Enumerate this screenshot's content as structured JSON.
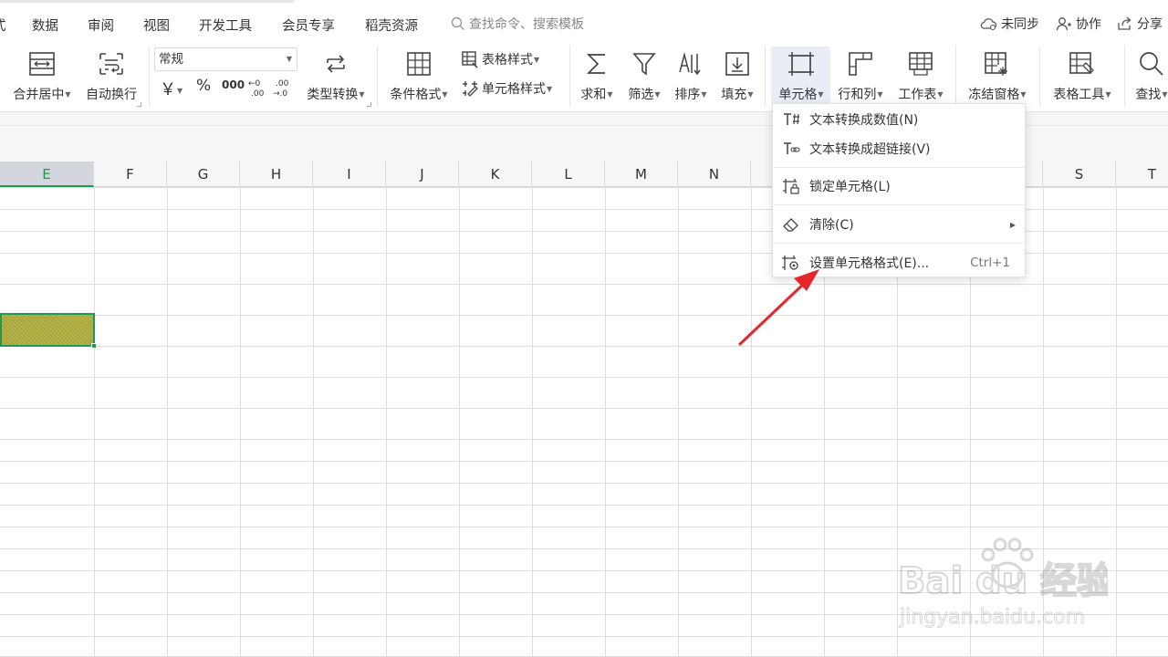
{
  "menu": {
    "partial_left": "式",
    "items": [
      "数据",
      "审阅",
      "视图",
      "开发工具",
      "会员专享",
      "稻壳资源"
    ],
    "search_placeholder": "查找命令、搜索模板",
    "right": {
      "sync": "未同步",
      "collab": "协作",
      "share": "分享"
    }
  },
  "ribbon": {
    "merge": "合并居中",
    "wrap": "自动换行",
    "format_value": "常规",
    "currency": "￥",
    "percent": "%",
    "thousands": "000",
    "dec_inc": "←0 .00",
    "dec_dec": ".00 →.0",
    "type_convert": "类型转换",
    "cond_format": "条件格式",
    "table_style": "表格样式",
    "cell_style": "单元格样式",
    "sum": "求和",
    "filter": "筛选",
    "sort": "排序",
    "fill": "填充",
    "cell": "单元格",
    "row_col": "行和列",
    "worksheet": "工作表",
    "freeze": "冻结窗格",
    "table_tools": "表格工具",
    "find": "查找"
  },
  "columns": [
    "E",
    "F",
    "G",
    "H",
    "I",
    "J",
    "K",
    "L",
    "M",
    "N",
    "",
    "",
    "",
    "",
    "S",
    "T"
  ],
  "cell_menu": {
    "items": [
      {
        "label": "文本转换成数值(N)",
        "icon": "text-to-number-icon"
      },
      {
        "label": "文本转换成超链接(V)",
        "icon": "text-to-link-icon"
      },
      {
        "label": "锁定单元格(L)",
        "icon": "lock-cell-icon"
      },
      {
        "label": "清除(C)",
        "icon": "eraser-icon"
      },
      {
        "label": "设置单元格格式(E)...",
        "icon": "format-cells-icon",
        "shortcut": "Ctrl+1"
      }
    ]
  },
  "watermark": {
    "brand": "Bai du 经验",
    "url": "jingyan.baidu.com"
  },
  "colors": {
    "accent": "#1e9b4b",
    "arrow": "#e5262a"
  }
}
